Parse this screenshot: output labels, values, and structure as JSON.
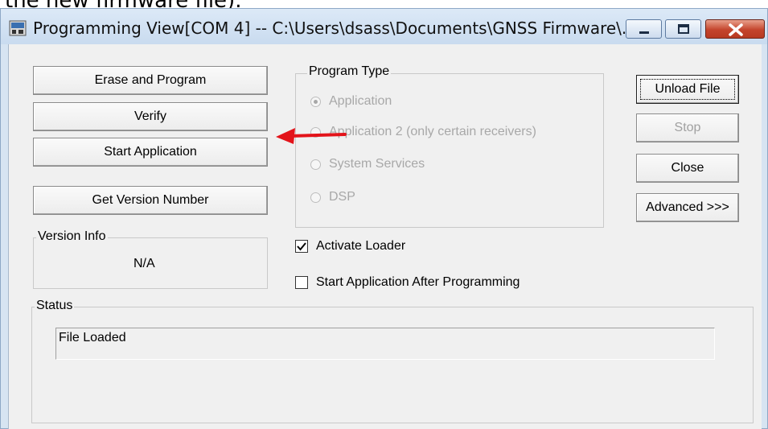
{
  "page": {
    "above_text": "the new firmware file)."
  },
  "window": {
    "title": "Programming View[COM 4] -- C:\\Users\\dsass\\Documents\\GNSS Firmware\\...",
    "controls": {
      "minimize": "minimize",
      "maximize": "maximize",
      "close": "close"
    }
  },
  "buttons": {
    "erase_program": "Erase and Program",
    "verify": "Verify",
    "start_application": "Start Application",
    "get_version": "Get Version Number",
    "unload_file": "Unload File",
    "stop": "Stop",
    "close": "Close",
    "advanced": "Advanced >>>"
  },
  "program_type": {
    "label": "Program Type",
    "options": [
      {
        "label": "Application",
        "selected": true
      },
      {
        "label": "Application 2 (only certain receivers)",
        "selected": false
      },
      {
        "label": "System Services",
        "selected": false
      },
      {
        "label": "DSP",
        "selected": false
      }
    ],
    "enabled": false
  },
  "version_info": {
    "label": "Version Info",
    "value": "N/A"
  },
  "checkboxes": {
    "activate_loader": {
      "label": "Activate Loader",
      "checked": true
    },
    "start_after": {
      "label": "Start Application After Programming",
      "checked": false
    }
  },
  "status": {
    "label": "Status",
    "text": "File Loaded"
  },
  "colors": {
    "arrow": "#e3131a",
    "close_button": "#c4442c",
    "title_bar": "#d7e4f2"
  }
}
